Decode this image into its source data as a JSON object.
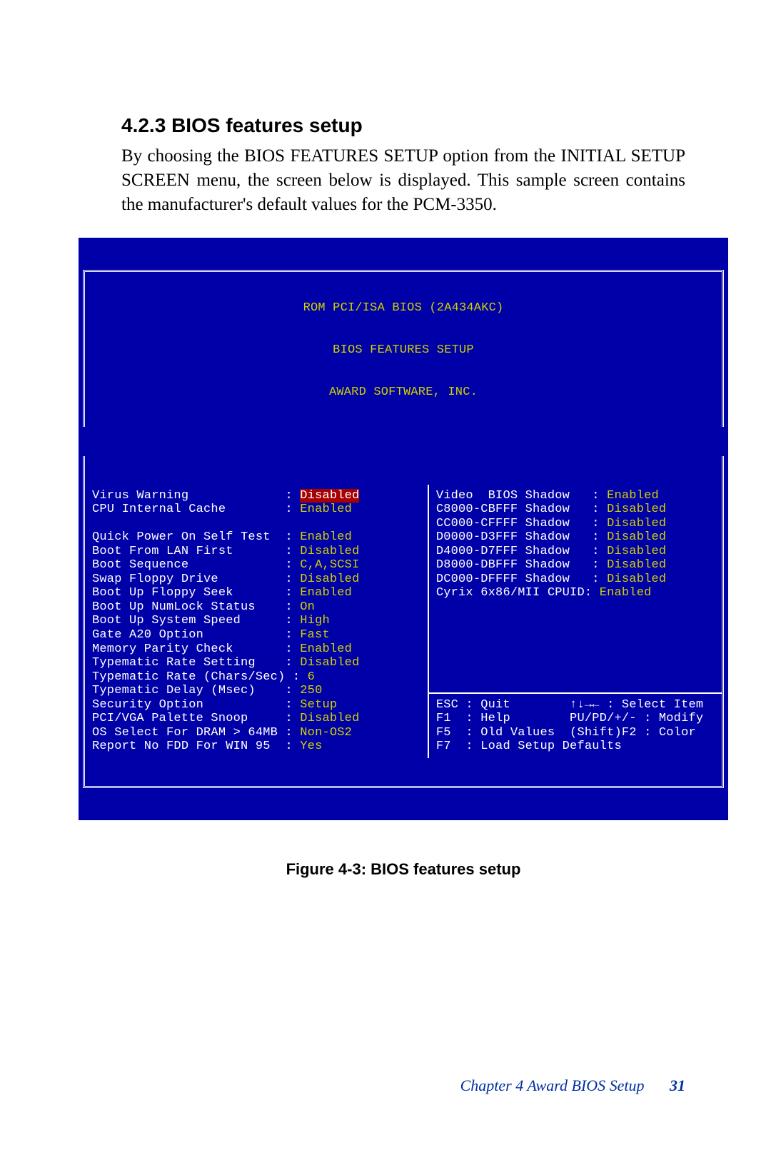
{
  "section_number": "4.2.3",
  "section_title": "BIOS features setup",
  "paragraph": "By choosing the BIOS FEATURES SETUP option from the INITIAL SETUP SCREEN menu, the screen below is displayed. This sample screen contains the manufacturer's default values for the PCM-3350.",
  "bios": {
    "header_lines": [
      "ROM PCI/ISA BIOS (2A434AKC)",
      "BIOS FEATURES SETUP",
      "AWARD SOFTWARE, INC."
    ],
    "left_rows": [
      {
        "label": "Virus Warning",
        "pad": "            ",
        "value": "Disabled",
        "style": "hi"
      },
      {
        "label": "CPU Internal Cache",
        "pad": "       ",
        "value": "Enabled",
        "style": "y"
      },
      {
        "label": "",
        "pad": "",
        "value": "",
        "style": "blank"
      },
      {
        "label": "Quick Power On Self Test",
        "pad": " ",
        "value": "Enabled",
        "style": "y"
      },
      {
        "label": "Boot From LAN First",
        "pad": "      ",
        "value": "Disabled",
        "style": "y"
      },
      {
        "label": "Boot Sequence",
        "pad": "            ",
        "value": "C,A,SCSI",
        "style": "y"
      },
      {
        "label": "Swap Floppy Drive",
        "pad": "        ",
        "value": "Disabled",
        "style": "y"
      },
      {
        "label": "Boot Up Floppy Seek",
        "pad": "      ",
        "value": "Enabled",
        "style": "y"
      },
      {
        "label": "Boot Up NumLock Status",
        "pad": "   ",
        "value": "On",
        "style": "y"
      },
      {
        "label": "Boot Up System Speed",
        "pad": "     ",
        "value": "High",
        "style": "y"
      },
      {
        "label": "Gate A20 Option",
        "pad": "          ",
        "value": "Fast",
        "style": "y"
      },
      {
        "label": "Memory Parity Check",
        "pad": "      ",
        "value": "Enabled",
        "style": "y"
      },
      {
        "label": "Typematic Rate Setting",
        "pad": "   ",
        "value": "Disabled",
        "style": "y"
      },
      {
        "label": "Typematic Rate (Chars/Sec)",
        "pad": "",
        "value": "6",
        "style": "y",
        "sep": " : "
      },
      {
        "label": "Typematic Delay (Msec)",
        "pad": "   ",
        "value": "250",
        "style": "y"
      },
      {
        "label": "Security Option",
        "pad": "          ",
        "value": "Setup",
        "style": "y"
      },
      {
        "label": "PCI/VGA Palette Snoop",
        "pad": "    ",
        "value": "Disabled",
        "style": "y"
      },
      {
        "label": "OS Select For DRAM > 64MB",
        "pad": " ",
        "value": "Non-OS2",
        "style": "y",
        "sep": ": "
      },
      {
        "label": "Report No FDD For WIN 95",
        "pad": " ",
        "value": "Yes",
        "style": "y"
      }
    ],
    "right_top_rows": [
      {
        "label": "Video  BIOS Shadow",
        "pad": "  ",
        "value": "Enabled",
        "style": "y"
      },
      {
        "label": "C8000-CBFFF Shadow",
        "pad": "  ",
        "value": "Disabled",
        "style": "y"
      },
      {
        "label": "CC000-CFFFF Shadow",
        "pad": "  ",
        "value": "Disabled",
        "style": "y"
      },
      {
        "label": "D0000-D3FFF Shadow",
        "pad": "  ",
        "value": "Disabled",
        "style": "y"
      },
      {
        "label": "D4000-D7FFF Shadow",
        "pad": "  ",
        "value": "Disabled",
        "style": "y"
      },
      {
        "label": "D8000-DBFFF Shadow",
        "pad": "  ",
        "value": "Disabled",
        "style": "y"
      },
      {
        "label": "DC000-DFFFF Shadow",
        "pad": "  ",
        "value": "Disabled",
        "style": "y"
      },
      {
        "label": "Cyrix 6x86/MII CPUID",
        "pad": "",
        "value": "Enabled",
        "style": "y",
        "sep": ": "
      }
    ],
    "help_lines": [
      "ESC : Quit        ↑↓→← : Select Item",
      "F1  : Help        PU/PD/+/- : Modify",
      "F5  : Old Values  (Shift)F2 : Color",
      "F7  : Load Setup Defaults"
    ]
  },
  "figure_caption": "Figure 4-3: BIOS features setup",
  "footer": {
    "chapter": "Chapter 4  Award BIOS Setup",
    "page": "31"
  }
}
